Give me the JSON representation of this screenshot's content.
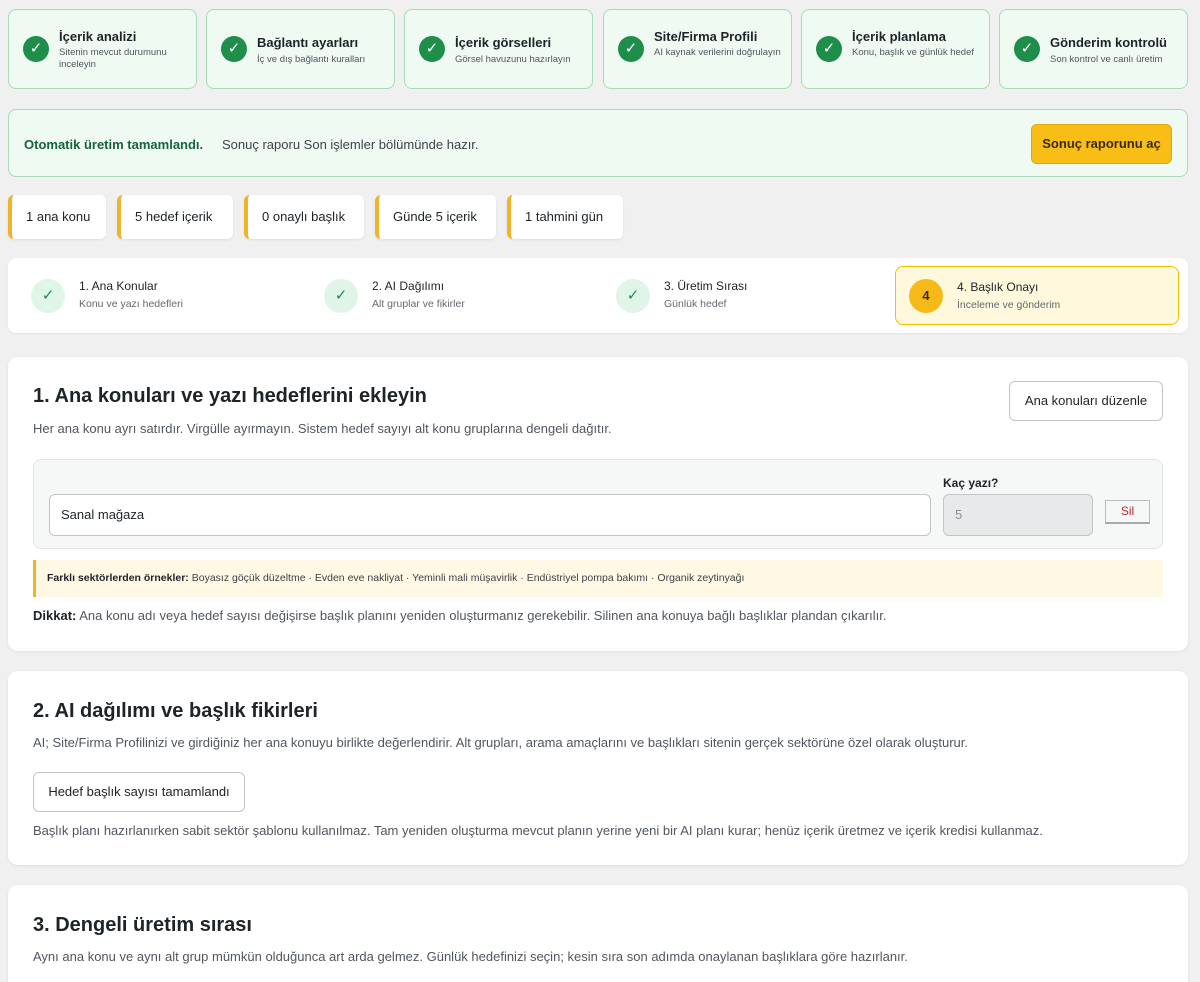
{
  "top_steps": [
    {
      "title": "İçerik analizi",
      "subtitle": "Sitenin mevcut durumunu inceleyin"
    },
    {
      "title": "Bağlantı ayarları",
      "subtitle": "İç ve dış bağlantı kuralları"
    },
    {
      "title": "İçerik görselleri",
      "subtitle": "Görsel havuzunu hazırlayın"
    },
    {
      "title": "Site/Firma Profili",
      "subtitle": "AI kaynak verilerini doğrulayın"
    },
    {
      "title": "İçerik planlama",
      "subtitle": "Konu, başlık ve günlük hedef"
    },
    {
      "title": "Gönderim kontrolü",
      "subtitle": "Son kontrol ve canlı üretim"
    }
  ],
  "banner": {
    "title": "Otomatik üretim tamamlandı.",
    "text": "Sonuç raporu Son işlemler bölümünde hazır.",
    "button": "Sonuç raporunu aç"
  },
  "stats": [
    "1 ana konu",
    "5 hedef içerik",
    "0 onaylı başlık",
    "Günde 5 içerik",
    "1 tahmini gün"
  ],
  "progress": [
    {
      "marker": "✓",
      "title": "1. Ana Konular",
      "subtitle": "Konu ve yazı hedefleri",
      "status": "done"
    },
    {
      "marker": "✓",
      "title": "2. AI Dağılımı",
      "subtitle": "Alt gruplar ve fikirler",
      "status": "done"
    },
    {
      "marker": "✓",
      "title": "3. Üretim Sırası",
      "subtitle": "Günlük hedef",
      "status": "done"
    },
    {
      "marker": "4",
      "title": "4. Başlık Onayı",
      "subtitle": "İnceleme ve gönderim",
      "status": "active"
    }
  ],
  "section1": {
    "title": "1. Ana konuları ve yazı hedeflerini ekleyin",
    "desc": "Her ana konu ayrı satırdır. Virgülle ayırmayın. Sistem hedef sayıyı alt konu gruplarına dengeli dağıtır.",
    "edit_button": "Ana konuları düzenle",
    "topic_value": "Sanal mağaza",
    "count_label": "Kaç yazı?",
    "count_value": "5",
    "delete_button": "Sil",
    "examples_label": "Farklı sektörlerden örnekler:",
    "examples_text": "Boyasız göçük düzeltme · Evden eve nakliyat · Yeminli mali müşavirlik · Endüstriyel pompa bakımı · Organik zeytinyağı",
    "note_label": "Dikkat:",
    "note_text": "Ana konu adı veya hedef sayısı değişirse başlık planını yeniden oluşturmanız gerekebilir. Silinen ana konuya bağlı başlıklar plandan çıkarılır."
  },
  "section2": {
    "title": "2. AI dağılımı ve başlık fikirleri",
    "desc": "AI; Site/Firma Profilinizi ve girdiğiniz her ana konuyu birlikte değerlendirir. Alt grupları, arama amaçlarını ve başlıkları sitenin gerçek sektörüne özel olarak oluşturur.",
    "button": "Hedef başlık sayısı tamamlandı",
    "note": "Başlık planı hazırlanırken sabit sektör şablonu kullanılmaz. Tam yeniden oluşturma mevcut planın yerine yeni bir AI planı kurar; henüz içerik üretmez ve içerik kredisi kullanmaz."
  },
  "section3": {
    "title": "3. Dengeli üretim sırası",
    "desc": "Aynı ana konu ve aynı alt grup mümkün olduğunca art arda gelmez. Günlük hedefinizi seçin; kesin sıra son adımda onaylanan başlıklara göre hazırlanır."
  },
  "colors": {
    "success": "#1e8e4a",
    "accent": "#f8be16",
    "panel_bg": "#effaf3"
  },
  "icons": {
    "done": "check-icon"
  }
}
